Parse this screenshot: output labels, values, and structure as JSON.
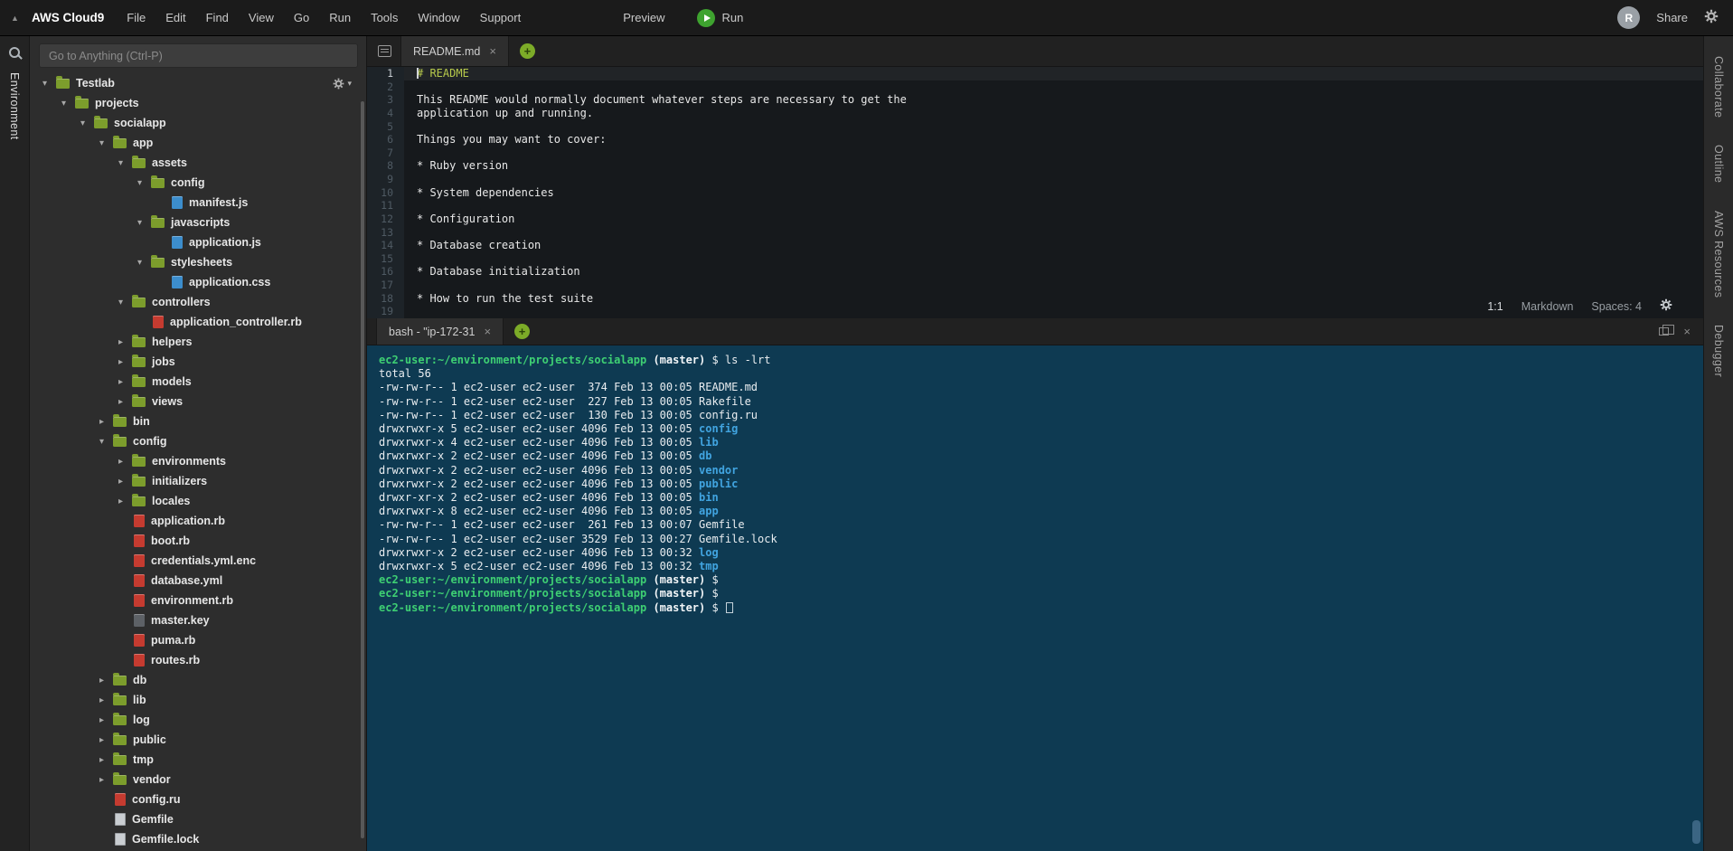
{
  "icons": {
    "close": "×",
    "plus": "+",
    "caret_down": "▾",
    "collapse_triangle": "▲"
  },
  "menubar": {
    "brand": "AWS Cloud9",
    "items": [
      "File",
      "Edit",
      "Find",
      "View",
      "Go",
      "Run",
      "Tools",
      "Window",
      "Support"
    ],
    "preview_label": "Preview",
    "run_label": "Run",
    "share_label": "Share",
    "avatar_letter": "R"
  },
  "left_rail": {
    "label": "Environment"
  },
  "right_rail": {
    "labels": [
      "Collaborate",
      "Outline",
      "AWS Resources",
      "Debugger"
    ]
  },
  "sidebar": {
    "search_placeholder": "Go to Anything (Ctrl-P)",
    "tree": [
      {
        "label": "Testlab",
        "level": 0,
        "kind": "folder",
        "state": "open",
        "root": true
      },
      {
        "label": "projects",
        "level": 1,
        "kind": "folder",
        "state": "open"
      },
      {
        "label": "socialapp",
        "level": 2,
        "kind": "folder",
        "state": "open"
      },
      {
        "label": "app",
        "level": 3,
        "kind": "folder",
        "state": "open"
      },
      {
        "label": "assets",
        "level": 4,
        "kind": "folder",
        "state": "open"
      },
      {
        "label": "config",
        "level": 5,
        "kind": "folder",
        "state": "open"
      },
      {
        "label": "manifest.js",
        "level": 6,
        "kind": "file",
        "ftype": "js"
      },
      {
        "label": "javascripts",
        "level": 5,
        "kind": "folder",
        "state": "open"
      },
      {
        "label": "application.js",
        "level": 6,
        "kind": "file",
        "ftype": "js"
      },
      {
        "label": "stylesheets",
        "level": 5,
        "kind": "folder",
        "state": "open"
      },
      {
        "label": "application.css",
        "level": 6,
        "kind": "file",
        "ftype": "css"
      },
      {
        "label": "controllers",
        "level": 4,
        "kind": "folder",
        "state": "open"
      },
      {
        "label": "application_controller.rb",
        "level": 5,
        "kind": "file",
        "ftype": "ruby"
      },
      {
        "label": "helpers",
        "level": 4,
        "kind": "folder",
        "state": "closed"
      },
      {
        "label": "jobs",
        "level": 4,
        "kind": "folder",
        "state": "closed"
      },
      {
        "label": "models",
        "level": 4,
        "kind": "folder",
        "state": "closed"
      },
      {
        "label": "views",
        "level": 4,
        "kind": "folder",
        "state": "closed"
      },
      {
        "label": "bin",
        "level": 3,
        "kind": "folder",
        "state": "closed"
      },
      {
        "label": "config",
        "level": 3,
        "kind": "folder",
        "state": "open"
      },
      {
        "label": "environments",
        "level": 4,
        "kind": "folder",
        "state": "closed"
      },
      {
        "label": "initializers",
        "level": 4,
        "kind": "folder",
        "state": "closed"
      },
      {
        "label": "locales",
        "level": 4,
        "kind": "folder",
        "state": "closed"
      },
      {
        "label": "application.rb",
        "level": 4,
        "kind": "file",
        "ftype": "ruby"
      },
      {
        "label": "boot.rb",
        "level": 4,
        "kind": "file",
        "ftype": "ruby"
      },
      {
        "label": "credentials.yml.enc",
        "level": 4,
        "kind": "file",
        "ftype": "ruby"
      },
      {
        "label": "database.yml",
        "level": 4,
        "kind": "file",
        "ftype": "ruby"
      },
      {
        "label": "environment.rb",
        "level": 4,
        "kind": "file",
        "ftype": "ruby"
      },
      {
        "label": "master.key",
        "level": 4,
        "kind": "file",
        "ftype": "key"
      },
      {
        "label": "puma.rb",
        "level": 4,
        "kind": "file",
        "ftype": "ruby"
      },
      {
        "label": "routes.rb",
        "level": 4,
        "kind": "file",
        "ftype": "ruby"
      },
      {
        "label": "db",
        "level": 3,
        "kind": "folder",
        "state": "closed"
      },
      {
        "label": "lib",
        "level": 3,
        "kind": "folder",
        "state": "closed"
      },
      {
        "label": "log",
        "level": 3,
        "kind": "folder",
        "state": "closed"
      },
      {
        "label": "public",
        "level": 3,
        "kind": "folder",
        "state": "closed"
      },
      {
        "label": "tmp",
        "level": 3,
        "kind": "folder",
        "state": "closed"
      },
      {
        "label": "vendor",
        "level": 3,
        "kind": "folder",
        "state": "closed"
      },
      {
        "label": "config.ru",
        "level": 3,
        "kind": "file",
        "ftype": "ruby"
      },
      {
        "label": "Gemfile",
        "level": 3,
        "kind": "file",
        "ftype": "text"
      },
      {
        "label": "Gemfile.lock",
        "level": 3,
        "kind": "file",
        "ftype": "text"
      }
    ]
  },
  "editor": {
    "tab_title": "README.md",
    "status": {
      "cursor_position": "1:1",
      "syntax_mode": "Markdown",
      "tab_size": "Spaces: 4"
    },
    "lines": [
      {
        "n": 1,
        "t": "# README",
        "h": true,
        "a": true
      },
      {
        "n": 2,
        "t": ""
      },
      {
        "n": 3,
        "t": "This README would normally document whatever steps are necessary to get the"
      },
      {
        "n": 4,
        "t": "application up and running."
      },
      {
        "n": 5,
        "t": ""
      },
      {
        "n": 6,
        "t": "Things you may want to cover:"
      },
      {
        "n": 7,
        "t": ""
      },
      {
        "n": 8,
        "t": "* Ruby version"
      },
      {
        "n": 9,
        "t": ""
      },
      {
        "n": 10,
        "t": "* System dependencies"
      },
      {
        "n": 11,
        "t": ""
      },
      {
        "n": 12,
        "t": "* Configuration"
      },
      {
        "n": 13,
        "t": ""
      },
      {
        "n": 14,
        "t": "* Database creation"
      },
      {
        "n": 15,
        "t": ""
      },
      {
        "n": 16,
        "t": "* Database initialization"
      },
      {
        "n": 17,
        "t": ""
      },
      {
        "n": 18,
        "t": "* How to run the test suite"
      },
      {
        "n": 19,
        "t": ""
      }
    ]
  },
  "terminal": {
    "tab_title": "bash - \"ip-172-31",
    "lines": [
      [
        [
          "g",
          "ec2-user:~/environment/projects/socialapp"
        ],
        [
          "w",
          " "
        ],
        [
          "wb",
          "(master)"
        ],
        [
          "w",
          " $ ls -lrt"
        ]
      ],
      [
        [
          "w",
          "total 56"
        ]
      ],
      [
        [
          "w",
          "-rw-rw-r-- 1 ec2-user ec2-user  374 Feb 13 00:05 README.md"
        ]
      ],
      [
        [
          "w",
          "-rw-rw-r-- 1 ec2-user ec2-user  227 Feb 13 00:05 Rakefile"
        ]
      ],
      [
        [
          "w",
          "-rw-rw-r-- 1 ec2-user ec2-user  130 Feb 13 00:05 config.ru"
        ]
      ],
      [
        [
          "w",
          "drwxrwxr-x 5 ec2-user ec2-user 4096 Feb 13 00:05 "
        ],
        [
          "b",
          "config"
        ]
      ],
      [
        [
          "w",
          "drwxrwxr-x 4 ec2-user ec2-user 4096 Feb 13 00:05 "
        ],
        [
          "b",
          "lib"
        ]
      ],
      [
        [
          "w",
          "drwxrwxr-x 2 ec2-user ec2-user 4096 Feb 13 00:05 "
        ],
        [
          "b",
          "db"
        ]
      ],
      [
        [
          "w",
          "drwxrwxr-x 2 ec2-user ec2-user 4096 Feb 13 00:05 "
        ],
        [
          "b",
          "vendor"
        ]
      ],
      [
        [
          "w",
          "drwxrwxr-x 2 ec2-user ec2-user 4096 Feb 13 00:05 "
        ],
        [
          "b",
          "public"
        ]
      ],
      [
        [
          "w",
          "drwxr-xr-x 2 ec2-user ec2-user 4096 Feb 13 00:05 "
        ],
        [
          "b",
          "bin"
        ]
      ],
      [
        [
          "w",
          "drwxrwxr-x 8 ec2-user ec2-user 4096 Feb 13 00:05 "
        ],
        [
          "b",
          "app"
        ]
      ],
      [
        [
          "w",
          "-rw-rw-r-- 1 ec2-user ec2-user  261 Feb 13 00:07 Gemfile"
        ]
      ],
      [
        [
          "w",
          "-rw-rw-r-- 1 ec2-user ec2-user 3529 Feb 13 00:27 Gemfile.lock"
        ]
      ],
      [
        [
          "w",
          "drwxrwxr-x 2 ec2-user ec2-user 4096 Feb 13 00:32 "
        ],
        [
          "b",
          "log"
        ]
      ],
      [
        [
          "w",
          "drwxrwxr-x 5 ec2-user ec2-user 4096 Feb 13 00:32 "
        ],
        [
          "b",
          "tmp"
        ]
      ],
      [
        [
          "g",
          "ec2-user:~/environment/projects/socialapp"
        ],
        [
          "w",
          " "
        ],
        [
          "wb",
          "(master)"
        ],
        [
          "w",
          " $"
        ]
      ],
      [
        [
          "g",
          "ec2-user:~/environment/projects/socialapp"
        ],
        [
          "w",
          " "
        ],
        [
          "wb",
          "(master)"
        ],
        [
          "w",
          " $"
        ]
      ],
      [
        [
          "g",
          "ec2-user:~/environment/projects/socialapp"
        ],
        [
          "w",
          " "
        ],
        [
          "wb",
          "(master)"
        ],
        [
          "w",
          " $ "
        ],
        [
          "cursor",
          ""
        ]
      ]
    ]
  },
  "colors": {
    "folder_green": "#7c9d2c",
    "ruby_red": "#c53b30",
    "js_blue": "#3c8dcc",
    "run_green": "#3ea32f",
    "plus_green": "#7cab28",
    "terminal_bg": "#0e3a52",
    "prompt_green": "#3ecf73",
    "dir_blue": "#41a4e0",
    "heading_green": "#b6c94b"
  }
}
